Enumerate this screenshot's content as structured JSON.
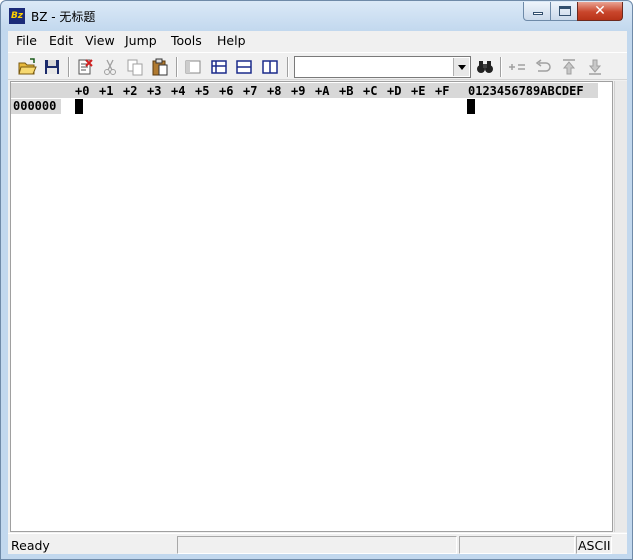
{
  "window": {
    "title": "BZ - 无标题",
    "app_icon_text": "Bz"
  },
  "menu": [
    "File",
    "Edit",
    "View",
    "Jump",
    "Tools",
    "Help"
  ],
  "toolbar": {
    "search_value": "",
    "buttons": [
      "open-icon",
      "save-icon",
      "close-file-icon",
      "cut-icon",
      "copy-icon",
      "paste-icon",
      "view-single-icon",
      "view-split-icon",
      "view-horizontal-icon",
      "view-vertical-icon",
      "find-icon",
      "compare-icon",
      "undo-icon",
      "jump-up-icon",
      "jump-down-icon"
    ]
  },
  "editor": {
    "column_headers": [
      "+0",
      "+1",
      "+2",
      "+3",
      "+4",
      "+5",
      "+6",
      "+7",
      "+8",
      "+9",
      "+A",
      "+B",
      "+C",
      "+D",
      "+E",
      "+F"
    ],
    "ascii_header": "0123456789ABCDEF",
    "rows": [
      {
        "address": "000000"
      }
    ]
  },
  "status": {
    "state": "Ready",
    "encoding": "ASCII"
  },
  "colors": {
    "frame": "#c2d8ee",
    "close_button": "#c9462c",
    "header_bg": "#d8d8d8"
  }
}
